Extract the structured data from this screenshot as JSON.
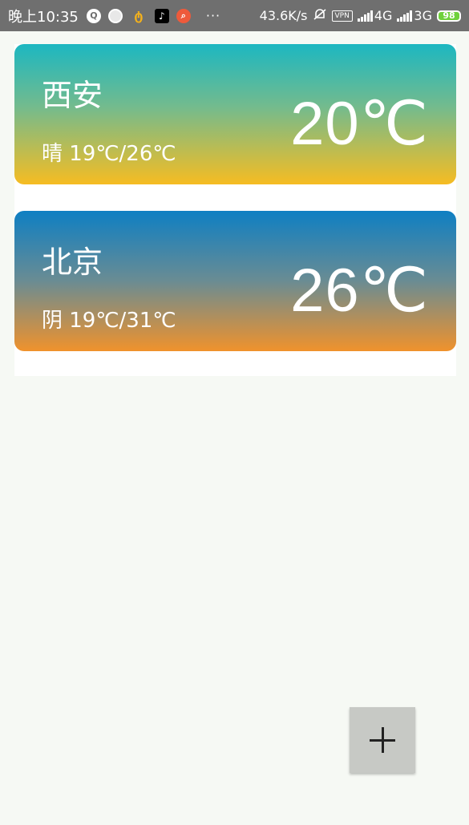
{
  "status_bar": {
    "time": "晚上10:35",
    "dots": "···",
    "net_speed": "43.6K/s",
    "vpn": "VPN",
    "network_1": "4G",
    "network_2": "3G",
    "battery": "98",
    "icons": [
      "q-app-icon",
      "circle-app-icon",
      "bird-app-icon",
      "tiktok-icon",
      "search-app-icon",
      "mute-alarm-icon",
      "signal-icon",
      "battery-icon"
    ]
  },
  "cities": [
    {
      "name": "西安",
      "desc": "晴 19℃/26℃",
      "temp": "20℃",
      "gradient": [
        "#1cb7c1",
        "#f6bc22"
      ]
    },
    {
      "name": "北京",
      "desc": "阴 19℃/31℃",
      "temp": "26℃",
      "gradient": [
        "#0e7fc3",
        "#f0922c"
      ]
    }
  ],
  "add_button": {
    "icon": "plus-icon"
  },
  "colors": {
    "status_bar_bg": "#6f6f6f",
    "page_bg": "#f6f9f4",
    "fab_bg": "#c7c9c5"
  }
}
